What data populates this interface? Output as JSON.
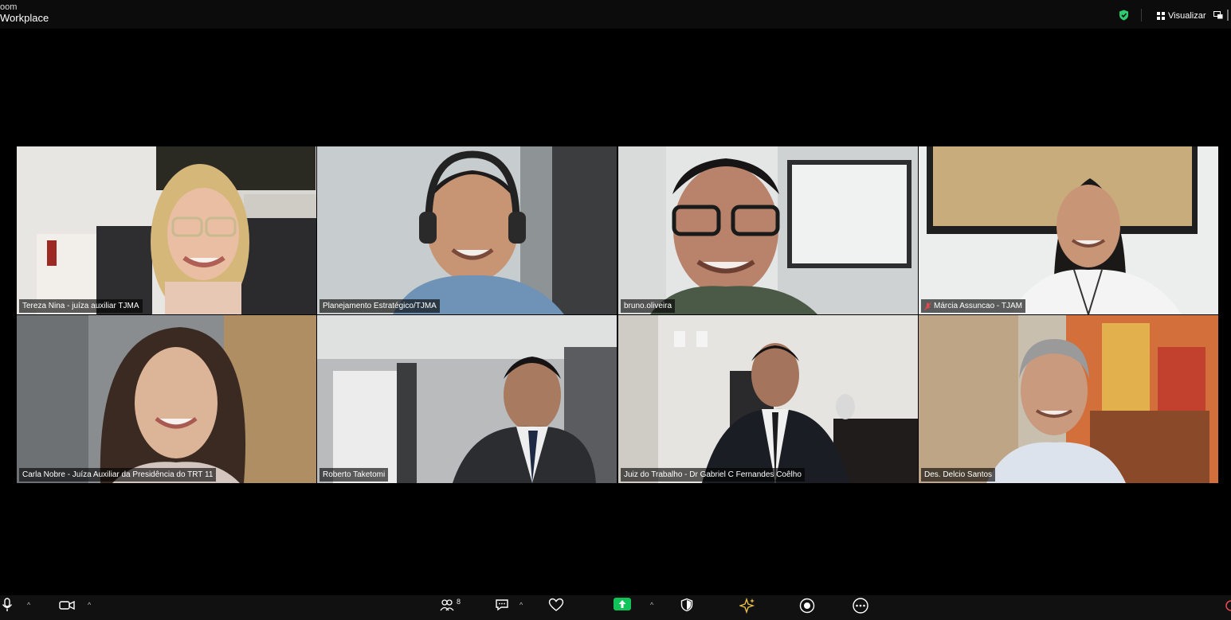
{
  "app": {
    "brand_line1": "oom",
    "brand_line2": "Workplace"
  },
  "header": {
    "view_label": "Visualizar"
  },
  "participants": [
    {
      "name": "Tereza Nina - juíza auxiliar TJMA",
      "active_speaker": true,
      "muted": false
    },
    {
      "name": "Planejamento Estratégico/TJMA",
      "active_speaker": false,
      "muted": false
    },
    {
      "name": "bruno.oliveira",
      "active_speaker": false,
      "muted": false
    },
    {
      "name": "Márcia Assuncao - TJAM",
      "active_speaker": false,
      "muted": true
    },
    {
      "name": "Carla Nobre - Juíza Auxiliar da Presidência do TRT 11",
      "active_speaker": false,
      "muted": false
    },
    {
      "name": "Roberto Taketomi",
      "active_speaker": false,
      "muted": false
    },
    {
      "name": "Juiz do Trabalho - Dr Gabriel C Fernandes Coêlho",
      "active_speaker": false,
      "muted": false
    },
    {
      "name": "Des. Delcio Santos",
      "active_speaker": false,
      "muted": false
    }
  ],
  "toolbar": {
    "participants_count": "8"
  },
  "colors": {
    "active_border": "#c9c05a",
    "share_green": "#10c45a",
    "secure_green": "#2ecc71",
    "mute_red": "#e5484d"
  }
}
